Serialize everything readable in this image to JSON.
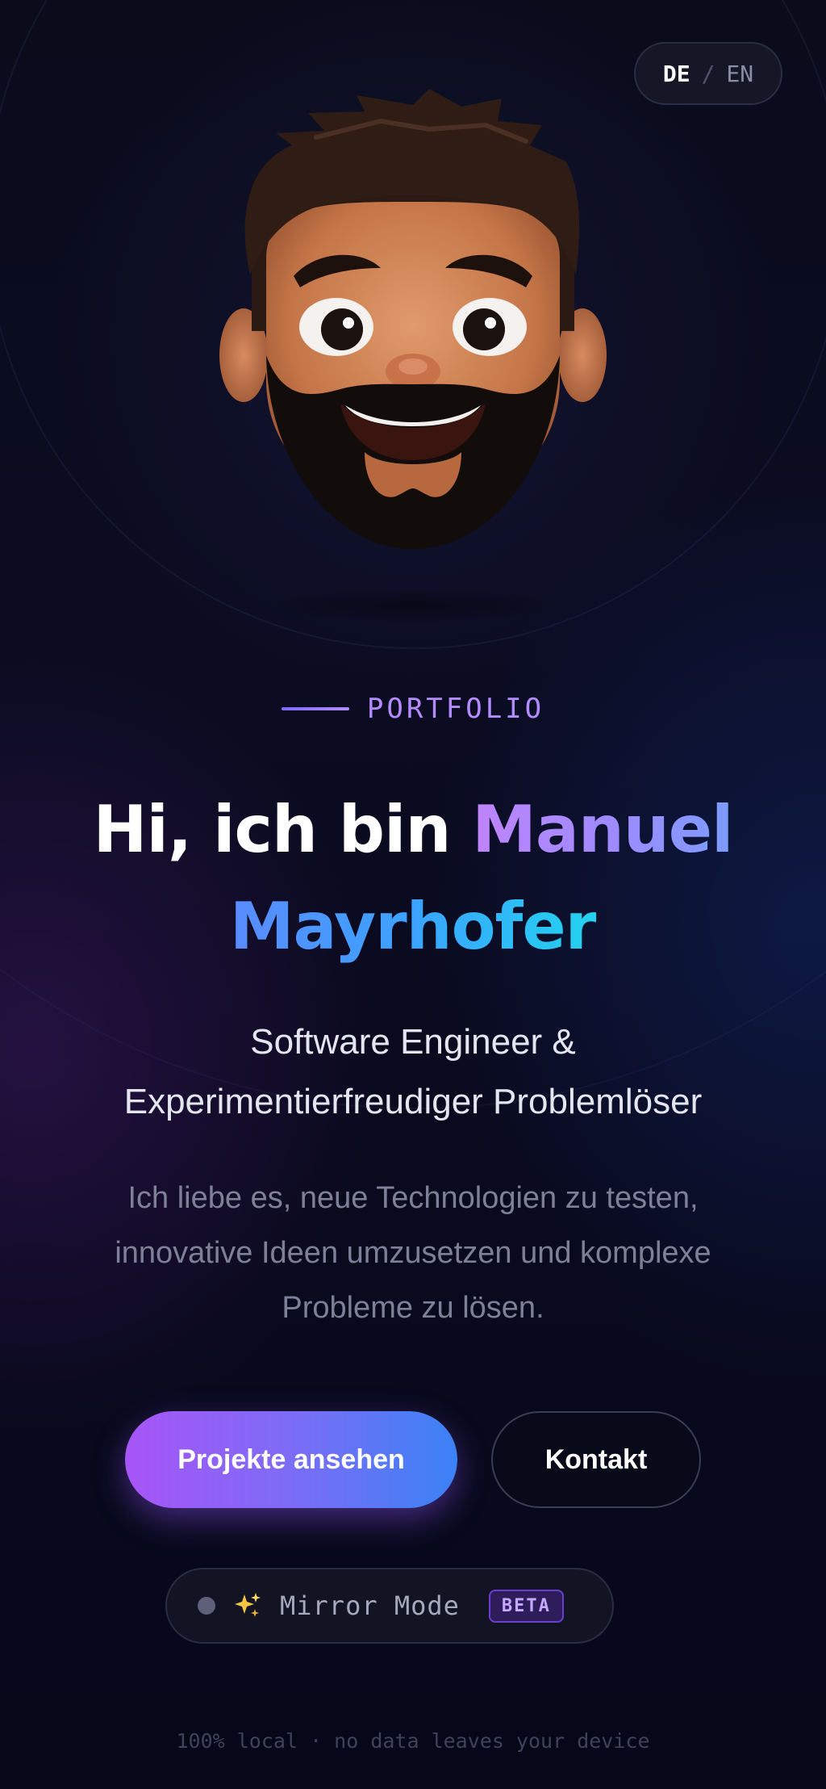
{
  "language_toggle": {
    "active": "DE",
    "separator": "/",
    "inactive": "EN"
  },
  "avatar": {
    "icon": "memoji-avatar"
  },
  "hero": {
    "eyebrow": "PORTFOLIO",
    "greeting": "Hi, ich bin ",
    "first_name": "Manuel",
    "last_name": "Mayrhofer",
    "subtitle_line1": "Software Engineer &",
    "subtitle_line2": "Experimentierfreudiger Problemlöser",
    "description_line1": "Ich liebe es, neue Technologien zu testen,",
    "description_line2": "innovative Ideen umzusetzen und komplexe",
    "description_line3": "Probleme zu lösen."
  },
  "actions": {
    "primary_label": "Projekte ansehen",
    "secondary_label": "Kontakt"
  },
  "mirror_mode": {
    "icon": "sparkles-icon",
    "label": "Mirror Mode",
    "badge": "BETA"
  },
  "footer": {
    "note": "100% local · no data leaves your device"
  },
  "colors": {
    "background": "#080a18",
    "accent_purple": "#a855f7",
    "accent_blue": "#3b82f6",
    "accent_cyan": "#22d3ee",
    "eyebrow": "#b48cff"
  }
}
